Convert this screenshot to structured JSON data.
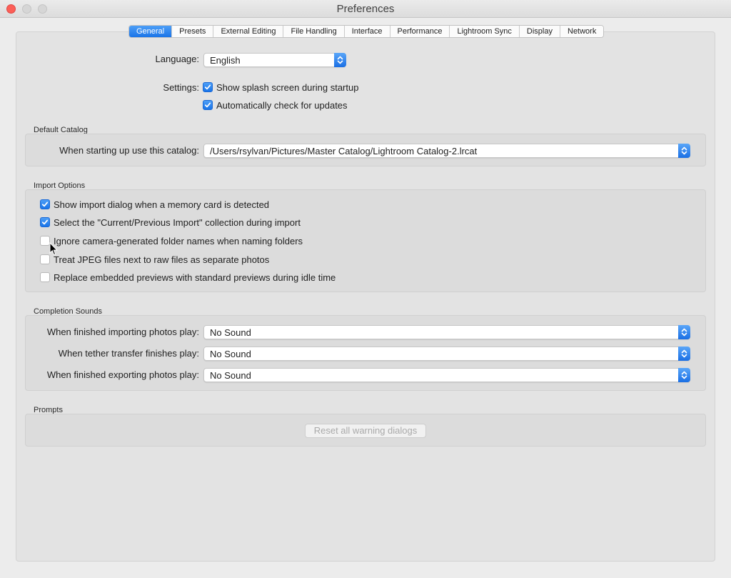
{
  "window": {
    "title": "Preferences"
  },
  "tabs": [
    {
      "label": "General",
      "active": true
    },
    {
      "label": "Presets",
      "active": false
    },
    {
      "label": "External Editing",
      "active": false
    },
    {
      "label": "File Handling",
      "active": false
    },
    {
      "label": "Interface",
      "active": false
    },
    {
      "label": "Performance",
      "active": false
    },
    {
      "label": "Lightroom Sync",
      "active": false
    },
    {
      "label": "Display",
      "active": false
    },
    {
      "label": "Network",
      "active": false
    }
  ],
  "general": {
    "language_label": "Language:",
    "language_value": "English",
    "settings_label": "Settings:",
    "show_splash": {
      "label": "Show splash screen during startup",
      "checked": true
    },
    "check_updates": {
      "label": "Automatically check for updates",
      "checked": true
    }
  },
  "default_catalog": {
    "title": "Default Catalog",
    "label": "When starting up use this catalog:",
    "value": "/Users/rsylvan/Pictures/Master Catalog/Lightroom Catalog-2.lrcat"
  },
  "import_options": {
    "title": "Import Options",
    "items": [
      {
        "label": "Show import dialog when a memory card is detected",
        "checked": true
      },
      {
        "label": "Select the \"Current/Previous Import\" collection during import",
        "checked": true
      },
      {
        "label": "Ignore camera-generated folder names when naming folders",
        "checked": false
      },
      {
        "label": "Treat JPEG files next to raw files as separate photos",
        "checked": false
      },
      {
        "label": "Replace embedded previews with standard previews during idle time",
        "checked": false
      }
    ]
  },
  "completion_sounds": {
    "title": "Completion Sounds",
    "import_label": "When finished importing photos play:",
    "import_value": "No Sound",
    "tether_label": "When tether transfer finishes play:",
    "tether_value": "No Sound",
    "export_label": "When finished exporting photos play:",
    "export_value": "No Sound"
  },
  "prompts": {
    "title": "Prompts",
    "reset_button": "Reset all warning dialogs"
  },
  "colors": {
    "accent": "#1a74e8",
    "close_button": "#fc5f57",
    "window_bg": "#ececec"
  }
}
